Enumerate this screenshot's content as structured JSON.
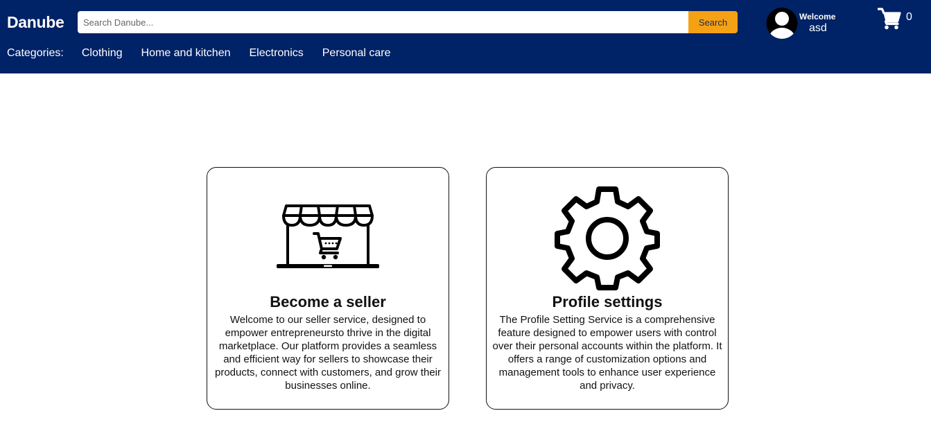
{
  "header": {
    "logo": "Danube",
    "search": {
      "placeholder": "Search Danube...",
      "value": "",
      "button_label": "Search"
    },
    "user": {
      "greeting": "Welcome",
      "name": "asd"
    },
    "cart": {
      "count": "0"
    },
    "categories": {
      "label": "Categories:",
      "items": [
        "Clothing",
        "Home and kitchen",
        "Electronics",
        "Personal care"
      ]
    }
  },
  "cards": {
    "seller": {
      "title": "Become a seller",
      "description": "Welcome to our seller service, designed to empower entrepreneursto thrive in the digital marketplace. Our platform provides a seamless and efficient way for sellers to showcase their products, connect with customers, and grow their businesses online."
    },
    "profile": {
      "title": "Profile settings",
      "description": "The Profile Setting Service is a comprehensive feature designed to empower users with control over their personal accounts within the platform. It offers a range of customization options and management tools to enhance user experience and privacy."
    }
  },
  "colors": {
    "header_bg": "#002266",
    "search_button": "#f5a114",
    "text": "#111111"
  },
  "icons": {
    "avatar": "user-avatar-icon",
    "cart": "shopping-cart-icon",
    "seller": "storefront-cart-icon",
    "profile": "gear-icon"
  }
}
